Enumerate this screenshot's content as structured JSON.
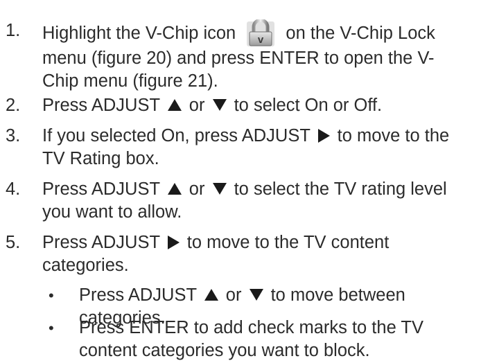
{
  "steps": [
    {
      "num": "1.",
      "line1_a": "Highlight the V-Chip icon",
      "line1_b": "on the V-Chip Lock",
      "line2": "menu (figure 20) and press ENTER to open the V-",
      "line3": "Chip menu (figure 21)."
    },
    {
      "num": "2.",
      "a": "Press ADJUST",
      "b": "or",
      "c": "to select On or Off."
    },
    {
      "num": "3.",
      "a": "If you selected On, press ADJUST",
      "b": "to move to the",
      "line2": "TV Rating box."
    },
    {
      "num": "4.",
      "a": "Press ADJUST",
      "b": "or",
      "c": "to select the TV rating level",
      "line2": "you want to allow."
    },
    {
      "num": "5.",
      "a": "Press ADJUST",
      "b": "to move to the TV content",
      "line2": "categories."
    }
  ],
  "bullets": [
    {
      "symbol": "•",
      "a": "Press ADJUST",
      "b": "or",
      "c": "to move between",
      "line2": "categories."
    },
    {
      "symbol": "•",
      "line1": "Press ENTER to add check marks to the TV",
      "line2": "content categories you want to block."
    }
  ],
  "icons": {
    "vchip": "vchip-lock-icon",
    "up": "up-triangle-icon",
    "down": "down-triangle-icon",
    "right": "right-triangle-icon"
  },
  "colors": {
    "text": "#2b2b2b",
    "arrow": "#1a1a1a"
  }
}
